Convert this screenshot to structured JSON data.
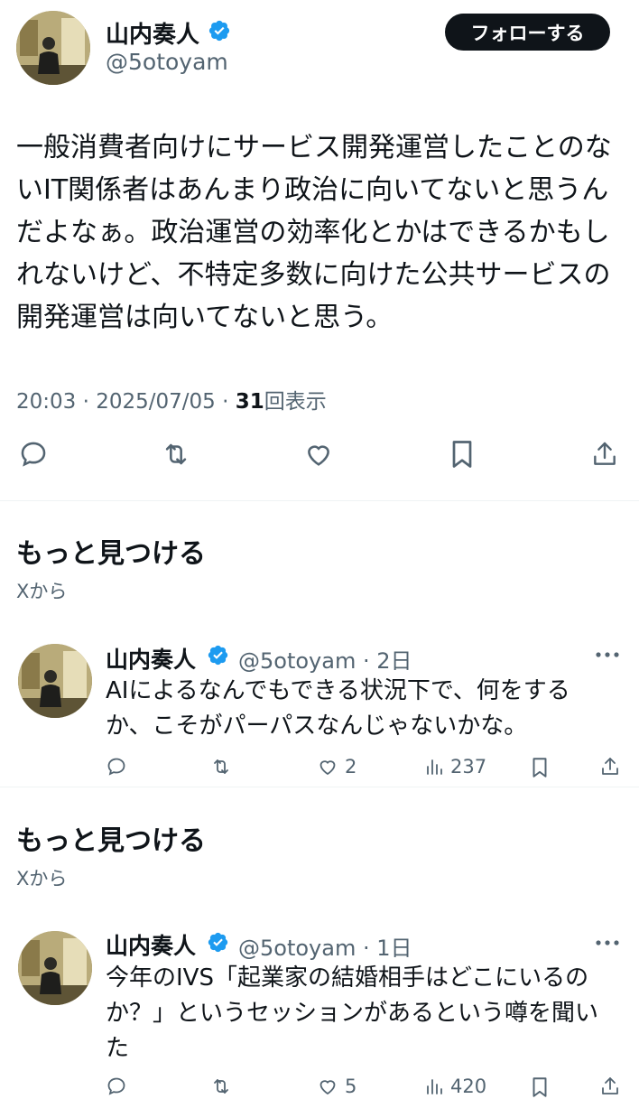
{
  "main_tweet": {
    "author_name": "山内奏人",
    "author_handle": "@5otoyam",
    "follow_label": "フォローする",
    "lines": [
      "一般消費者向けにサービス開発運営したことのな",
      "いIT関係者はあんまり政治に向いてないと思うん",
      "だよなぁ。政治運営の効率化とかはできるかもし",
      "れないけど、不特定多数に向けた公共サービスの",
      "開発運営は向いてないと思う。"
    ],
    "time": "20:03 · 2025/07/05 · ",
    "views_count": "31",
    "views_label": "回表示"
  },
  "sections": [
    {
      "title": "もっと見つける",
      "subtitle": "Xから",
      "tweet": {
        "author_name": "山内奏人",
        "handle_time": "@5otoyam · 2日",
        "lines": [
          "AIによるなんでもできる状況下で、何をする",
          "か、こそがパーパスなんじゃないかな。"
        ],
        "likes": "2",
        "views": "237"
      }
    },
    {
      "title": "もっと見つける",
      "subtitle": "Xから",
      "tweet": {
        "author_name": "山内奏人",
        "handle_time": "@5otoyam · 1日",
        "lines": [
          "今年のIVS「起業家の結婚相手はどこにいるの",
          "か？」というセッションがあるという噂を聞い",
          "た"
        ],
        "likes": "5",
        "views": "420"
      }
    }
  ],
  "colors": {
    "text": "#0f1419",
    "secondary": "#536471",
    "verified": "#1d9bf0",
    "button_bg": "#0f1419",
    "divider": "#eff3f4"
  }
}
